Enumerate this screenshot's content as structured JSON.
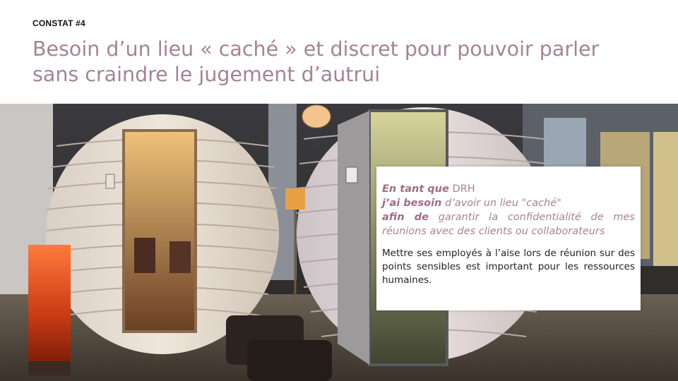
{
  "slide": {
    "tag": "CONSTAT #4",
    "title": "Besoin d’un lieu « caché » et discret pour pouvoir parler sans craindre le jugement d’autrui"
  },
  "story": {
    "role_kw": "En tant que",
    "role": "DRH",
    "need_kw": "j’ai besoin",
    "need": "d’avoir un lieu \"caché\"",
    "goal_kw": "afin de",
    "goal": "garantir la confidentialité de mes réunions avec des clients ou collaborateurs"
  },
  "description": "Mettre ses employés à l’aise lors de réunion sur des points sensibles est important pour les ressources humaines.",
  "colors": {
    "title": "#a58397",
    "keyword": "#a06c86",
    "text": "#222222",
    "background": "#ffffff"
  }
}
